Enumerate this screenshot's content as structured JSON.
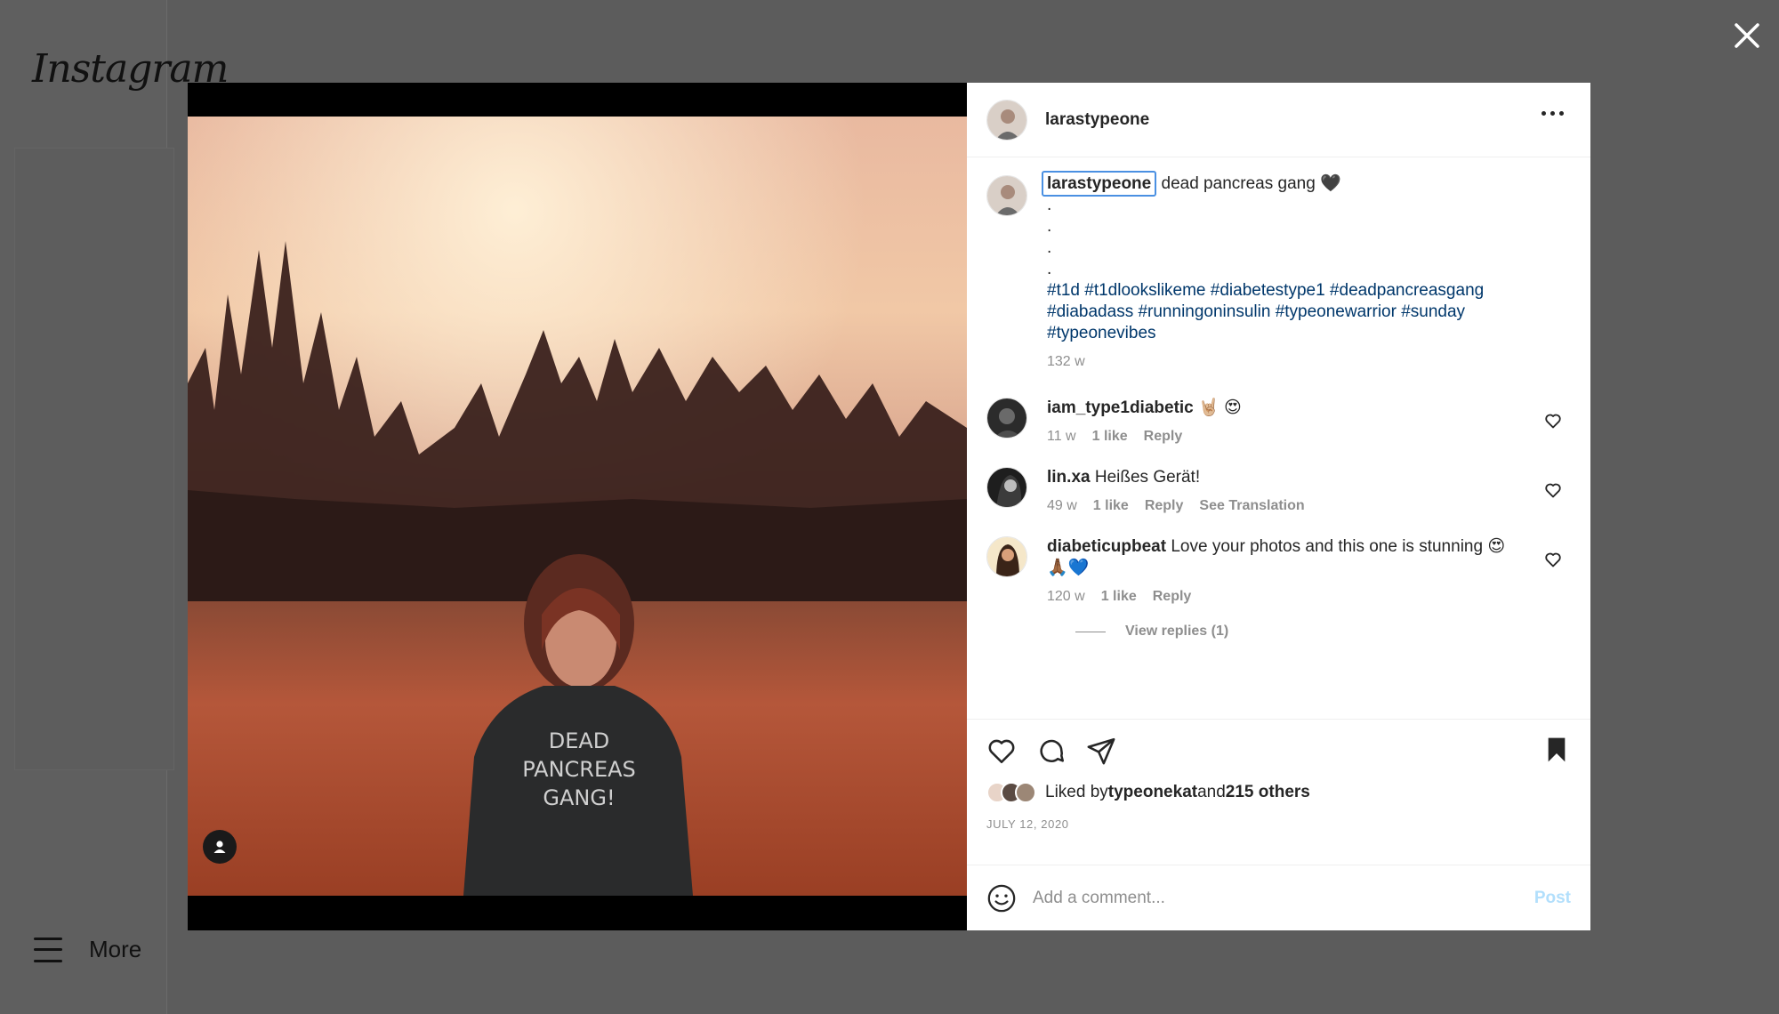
{
  "app": {
    "logo": "Instagram",
    "more_label": "More"
  },
  "post": {
    "username": "larastypeone",
    "caption_text": "dead pancreas gang 🖤",
    "caption_dots": [
      ".",
      ".",
      ".",
      "."
    ],
    "hashtags_lines": [
      "#t1d #t1dlookslikeme #diabetestype1 #deadpancreasgang",
      "#diabadass #runningoninsulin #typeonewarrior #sunday",
      "#typeonevibes"
    ],
    "caption_time": "132 w",
    "image_alt": "Woman in DEAD PANCREAS GANG hoodie standing in a field at sunset"
  },
  "comments": [
    {
      "user": "iam_type1diabetic",
      "text": "🤘🏼 😍",
      "time": "11 w",
      "likes": "1 like",
      "reply": "Reply",
      "extra": ""
    },
    {
      "user": "lin.xa",
      "text": "Heißes Gerät!",
      "time": "49 w",
      "likes": "1 like",
      "reply": "Reply",
      "extra": "See Translation"
    },
    {
      "user": "diabeticupbeat",
      "text": "Love your photos and this one is stunning 😍",
      "text2": "🙏🏾💙",
      "time": "120 w",
      "likes": "1 like",
      "reply": "Reply",
      "extra": "",
      "view_replies": "View replies (1)"
    }
  ],
  "likes": {
    "prefix": "Liked by ",
    "user": "typeonekat",
    "mid": " and ",
    "others": "215 others"
  },
  "date": "JULY 12, 2020",
  "comment_box": {
    "placeholder": "Add a comment...",
    "post_label": "Post"
  },
  "colors": {
    "link": "#00376b",
    "muted": "#8e8e8e",
    "post_disabled": "#b2dffc",
    "overlay": "#5c5c5c"
  }
}
